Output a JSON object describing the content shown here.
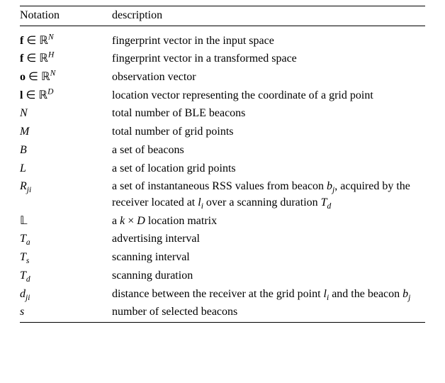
{
  "header": {
    "col_notation": "Notation",
    "col_description": "description"
  },
  "rows": [
    {
      "notation_html": "<span class='bf'>f</span> ∈ ℝ<span class='sup'>N</span>",
      "description": "fingerprint vector in the input space"
    },
    {
      "notation_html": "<span class='bf'>f</span> ∈ ℝ<span class='sup'>H</span>",
      "description": "fingerprint vector in a transformed space"
    },
    {
      "notation_html": "<span class='bf'>o</span> ∈ ℝ<span class='sup'>N</span>",
      "description": "observation vector"
    },
    {
      "notation_html": "<span class='bf'>l</span> ∈ ℝ<span class='sup'>D</span>",
      "description": "location vector representing the coordinate of a grid point"
    },
    {
      "notation_html": "<span class='it'>N</span>",
      "description": "total number of BLE beacons"
    },
    {
      "notation_html": "<span class='it'>M</span>",
      "description": "total number of grid points"
    },
    {
      "notation_html": "<span class='it'>B</span>",
      "description": "a set of beacons"
    },
    {
      "notation_html": "<span class='it'>L</span>",
      "description": "a set of location grid points"
    },
    {
      "notation_html": "<span class='cal'>R</span><span class='sub'>ji</span>",
      "description_html": "a set of instantaneous RSS values from beacon <span class='it'>b<span class='sub'>j</span></span>, acquired by the receiver located at <span class='it'>l<span class='sub'>i</span></span> over a scanning duration <span class='it'>T<span class='sub'>d</span></span>"
    },
    {
      "notation_html": "𝕃",
      "description_html": "a <span class='it'>k</span> × <span class='it'>D</span> location matrix"
    },
    {
      "notation_html": "<span class='it'>T<span class='sub'>a</span></span>",
      "description": "advertising interval"
    },
    {
      "notation_html": "<span class='it'>T<span class='sub'>s</span></span>",
      "description": "scanning interval"
    },
    {
      "notation_html": "<span class='it'>T<span class='sub'>d</span></span>",
      "description": "scanning duration"
    },
    {
      "notation_html": "<span class='it'>d<span class='sub'>ji</span></span>",
      "description_html": "distance between the receiver at the grid point <span class='it'>l<span class='sub'>i</span></span> and the beacon <span class='it'>b<span class='sub'>j</span></span>"
    },
    {
      "notation_html": "<span class='it'>s</span>",
      "description": "number of selected beacons"
    }
  ]
}
